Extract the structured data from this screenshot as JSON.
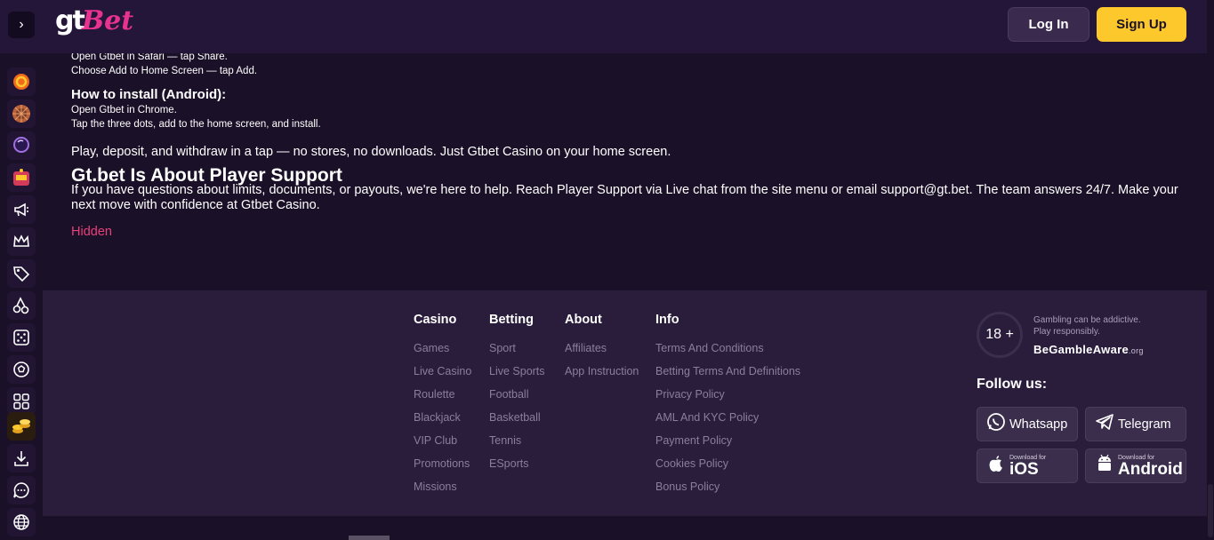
{
  "header": {
    "logo_gt": "gt",
    "logo_bet": "Bet",
    "login_label": "Log In",
    "signup_label": "Sign Up"
  },
  "article": {
    "ios_line1": "Open Gtbet in Safari — tap Share.",
    "ios_line2": "Choose Add to Home Screen — tap Add.",
    "android_heading": "How to install (Android):",
    "android_line1": "Open Gtbet in Chrome.",
    "android_line2": "Tap the three dots, add to the home screen, and install.",
    "play_text": "Play, deposit, and withdraw in a tap — no stores, no downloads. Just Gtbet Casino on your home screen.",
    "support_heading": "Gt.bet Is About Player Support",
    "support_text": "If you have questions about limits, documents, or payouts, we're here to help. Reach Player Support via Live chat from the site menu or email support@gt.bet. The team answers 24/7. Make your next move with confidence at Gtbet Casino.",
    "hidden_link": "Hidden"
  },
  "footer": {
    "columns": [
      {
        "title": "Casino",
        "items": [
          "Games",
          "Live Casino",
          "Roulette",
          "Blackjack",
          "VIP Club",
          "Promotions",
          "Missions"
        ]
      },
      {
        "title": "Betting",
        "items": [
          "Sport",
          "Live Sports",
          "Football",
          "Basketball",
          "Tennis",
          "ESports"
        ]
      },
      {
        "title": "About",
        "items": [
          "Affiliates",
          "App Instruction"
        ]
      },
      {
        "title": "Info",
        "items": [
          "Terms And Conditions",
          "Betting Terms And Definitions",
          "Privacy Policy",
          "AML And KYC Policy",
          "Payment Policy",
          "Cookies Policy",
          "Bonus Policy"
        ]
      }
    ],
    "age_badge": "18 +",
    "gamble_line1": "Gambling can be addictive.",
    "gamble_line2": "Play responsibly.",
    "begamble": "BeGambleAware",
    "begamble_org": ".org",
    "follow_us": "Follow us:",
    "whatsapp": "Whatsapp",
    "telegram": "Telegram",
    "ios_small": "Download for",
    "ios_big": "iOS",
    "android_small": "Download for",
    "android_big": "Android"
  },
  "sidebar_icons": [
    "gtbet-coin-icon",
    "roulette-wheel-icon",
    "crystal-ball-icon",
    "slot-machine-icon",
    "megaphone-icon",
    "crown-icon",
    "tag-icon",
    "cherries-icon",
    "dice-icon",
    "soccer-ball-icon",
    "grid-icon",
    "coins-icon",
    "download-icon",
    "chat-icon",
    "globe-icon"
  ],
  "colors": {
    "accent_yellow": "#fcc82c",
    "brand_pink": "#e8328f",
    "hidden_link": "#e8407a",
    "background": "#1a1027",
    "footer_bg": "#2a1d3c"
  }
}
